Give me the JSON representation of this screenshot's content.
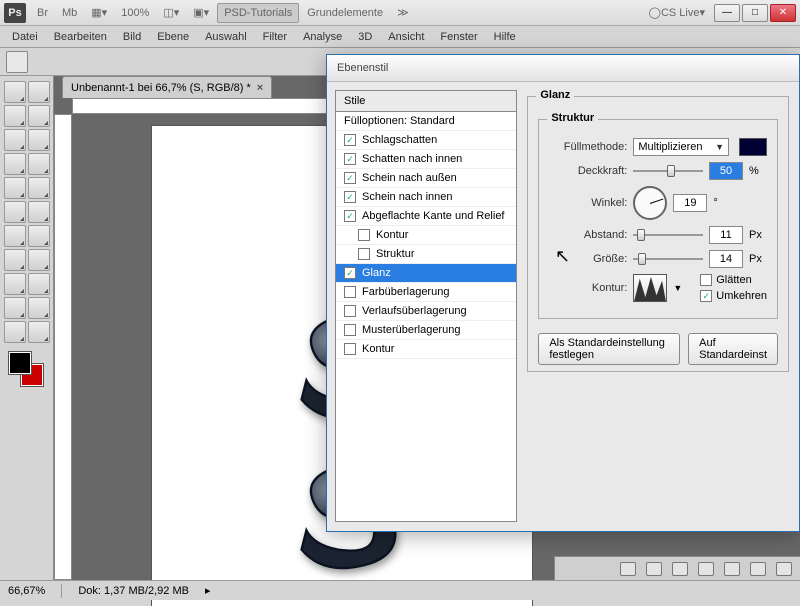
{
  "app": {
    "logo": "Ps",
    "zoom": "100%",
    "workspace1": "PSD-Tutorials",
    "workspace2": "Grundelemente",
    "cslive": "CS Live"
  },
  "menu": [
    "Datei",
    "Bearbeiten",
    "Bild",
    "Ebene",
    "Auswahl",
    "Filter",
    "Analyse",
    "3D",
    "Ansicht",
    "Fenster",
    "Hilfe"
  ],
  "tab": {
    "label": "Unbenannt-1 bei 66,7% (S, RGB/8) *"
  },
  "status": {
    "zoom": "66,67%",
    "doc": "Dok: 1,37 MB/2,92 MB"
  },
  "dialog": {
    "title": "Ebenenstil",
    "styles_header": "Stile",
    "blend_opts": "Fülloptionen: Standard",
    "styles": [
      {
        "label": "Schlagschatten",
        "checked": true
      },
      {
        "label": "Schatten nach innen",
        "checked": true
      },
      {
        "label": "Schein nach außen",
        "checked": true
      },
      {
        "label": "Schein nach innen",
        "checked": true
      },
      {
        "label": "Abgeflachte Kante und Relief",
        "checked": true
      },
      {
        "label": "Kontur",
        "checked": false,
        "sub": true
      },
      {
        "label": "Struktur",
        "checked": false,
        "sub": true
      },
      {
        "label": "Glanz",
        "checked": true,
        "selected": true
      },
      {
        "label": "Farbüberlagerung",
        "checked": false
      },
      {
        "label": "Verlaufsüberlagerung",
        "checked": false
      },
      {
        "label": "Musterüberlagerung",
        "checked": false
      },
      {
        "label": "Kontur",
        "checked": false
      }
    ],
    "section": "Glanz",
    "subsection": "Struktur",
    "labels": {
      "fill_method": "Füllmethode:",
      "opacity": "Deckkraft:",
      "angle": "Winkel:",
      "distance": "Abstand:",
      "size": "Größe:",
      "contour": "Kontur:",
      "antialias": "Glätten",
      "invert": "Umkehren"
    },
    "values": {
      "fill_method": "Multiplizieren",
      "opacity": "50",
      "angle": "19",
      "distance": "11",
      "size": "14"
    },
    "units": {
      "pct": "%",
      "deg": "°",
      "px": "Px"
    },
    "buttons": {
      "default1": "Als Standardeinstellung festlegen",
      "default2": "Auf Standardeinst"
    }
  }
}
